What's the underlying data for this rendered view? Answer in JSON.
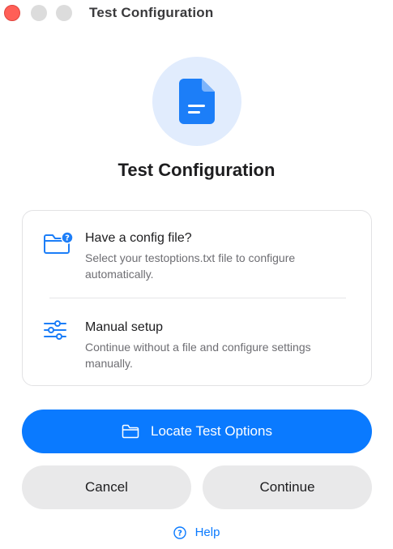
{
  "window": {
    "title": "Test Configuration"
  },
  "hero": {
    "icon": "document-icon",
    "heading": "Test Configuration"
  },
  "options": [
    {
      "icon": "folder-question-icon",
      "title": "Have a config file?",
      "description": "Select your testoptions.txt file to configure automatically."
    },
    {
      "icon": "sliders-icon",
      "title": "Manual setup",
      "description": "Continue without a file and configure settings manually."
    }
  ],
  "actions": {
    "primary_label": "Locate Test Options",
    "primary_icon": "folder-icon",
    "cancel_label": "Cancel",
    "continue_label": "Continue",
    "help_label": "Help",
    "help_icon": "question-circle-icon"
  },
  "colors": {
    "accent": "#0a7aff",
    "hero_bg": "#e1ecfd",
    "secondary_button_bg": "#e9e9ea",
    "close_button": "#ff5f57"
  }
}
